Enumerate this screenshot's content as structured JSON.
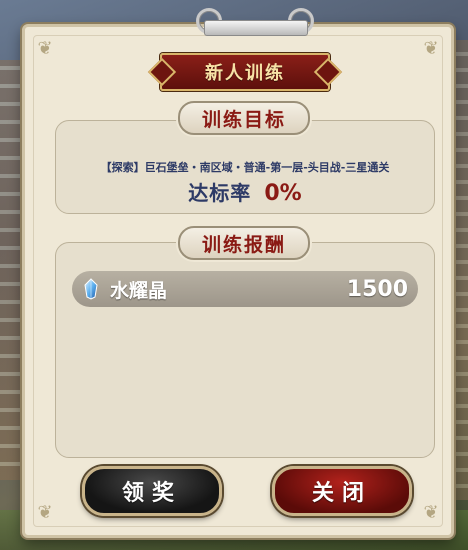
{
  "dialog": {
    "title": "新人训练"
  },
  "goal_section": {
    "heading": "训练目标",
    "description": "【探索】巨石堡垒・南区域・普通-第一层-头目战-三星通关",
    "rate_label": "达标率",
    "rate_value": "0%"
  },
  "reward_section": {
    "heading": "训练报酬",
    "items": [
      {
        "icon": "crystal-icon",
        "name": "水耀晶",
        "amount": "1500"
      }
    ]
  },
  "buttons": {
    "claim_label": "领奖",
    "close_label": "关闭"
  },
  "colors": {
    "title_banner": "#7a1a14",
    "heading_text": "#8a1a14",
    "navy_text": "#2d3a66",
    "claim_button": "#151515",
    "close_button": "#8a1a14"
  }
}
